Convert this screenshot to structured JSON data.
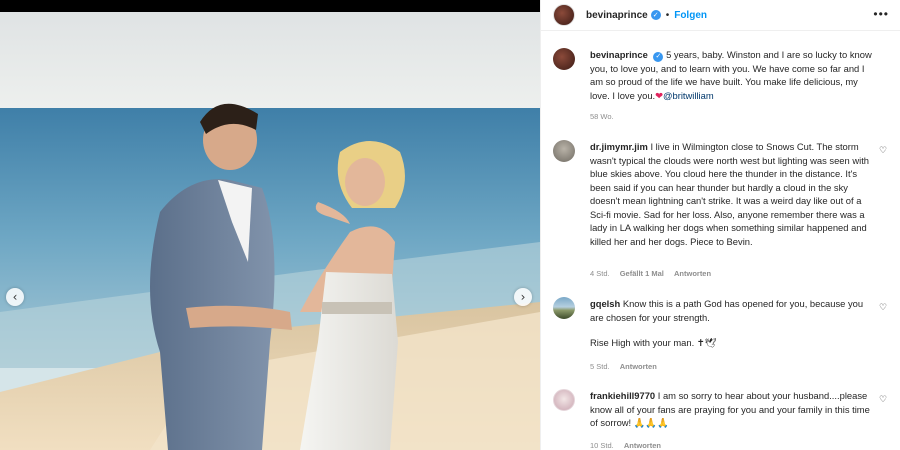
{
  "post": {
    "author": "bevinaprince",
    "follow_label": "Folgen",
    "more_label": "•••",
    "caption_text": "5 years, baby. Winston and I are so lucky to know you, to love you, and to learn with you. We have come so far and I am so proud of the life we have built. You make life delicious, my love. I love you.",
    "caption_emoji": "❤",
    "caption_mention": "@britwilliam",
    "time": "58 Wo."
  },
  "photo": {
    "prev_glyph": "‹",
    "next_glyph": "›"
  },
  "comments": [
    {
      "user": "dr.jimymr.jim",
      "text": "I live in Wilmington close to Snows Cut. The storm wasn't typical the clouds were north west but lighting was seen with blue skies above. You cloud here the thunder in the distance. It's been said if you can hear thunder but hardly a cloud in the sky doesn't mean lightning can't strike. It was a weird day like out of a Sci-fi movie. Sad for her loss. Also, anyone remember there was a lady in LA walking her dogs when something similar happened and killed her and her dogs. Piece to Bevin.",
      "time": "4 Std.",
      "likes": "Gefällt 1 Mal",
      "reply": "Antworten"
    },
    {
      "user": "gqelsh",
      "text": "Know this is a path God has opened for you, because you are chosen for your strength.",
      "text2": "Rise High with your man. ✝🕊",
      "time": "5 Std.",
      "reply": "Antworten"
    },
    {
      "user": "frankiehill9770",
      "text": "I am so sorry to hear about your husband....please know all of your fans are praying for you and your family in this time of sorrow! 🙏🙏🙏",
      "time": "10 Std.",
      "reply": "Antworten"
    }
  ],
  "icons": {
    "heart": "♡",
    "verified": "✓"
  },
  "colors": {
    "accent": "#0095f6",
    "verified": "#3897f0",
    "meta_text": "#8e8e8e"
  }
}
